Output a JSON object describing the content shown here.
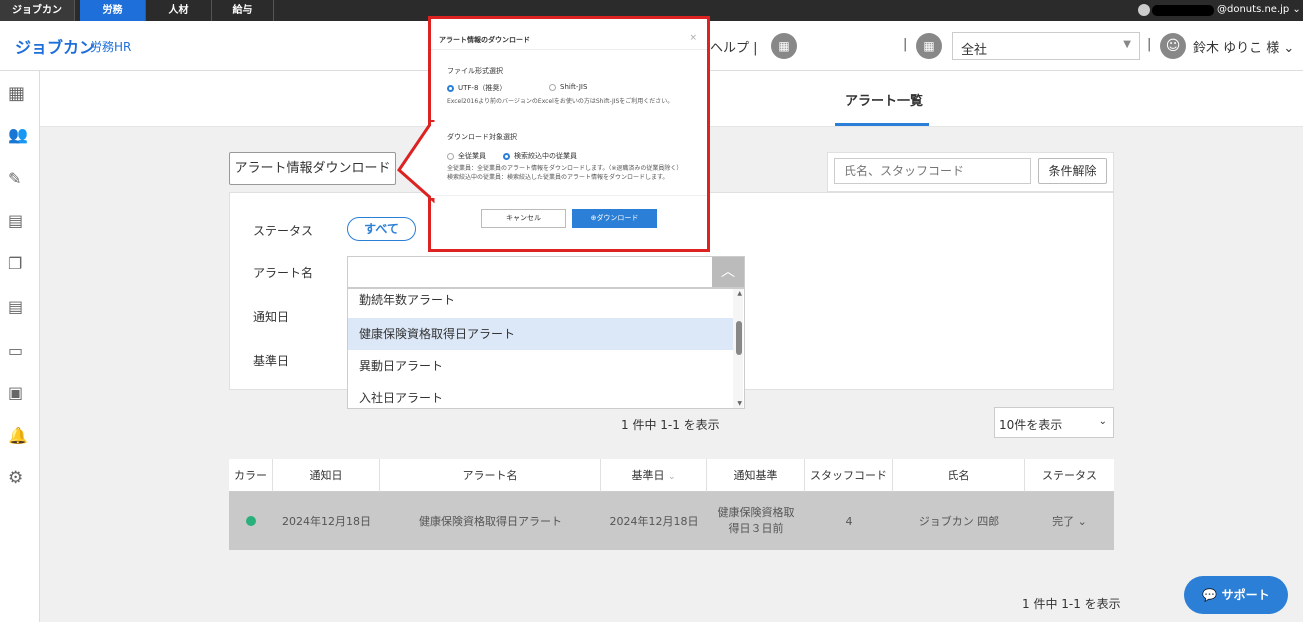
{
  "topbar": {
    "brand": "ジョブカン",
    "tabs": [
      "労務",
      "人材",
      "給与"
    ],
    "account_email": "@donuts.ne.jp"
  },
  "header": {
    "logo": "ジョブカン",
    "product": "労務HR",
    "help": "ヘルプ",
    "company_select": "全社",
    "user_name": "鈴木 ゆりこ 様"
  },
  "tabs": {
    "alert_list": "アラート一覧"
  },
  "toolbar": {
    "download_button": "アラート情報ダウンロード",
    "search_placeholder": "氏名、スタッフコード",
    "clear_button": "条件解除"
  },
  "filters": {
    "status_label": "ステータス",
    "status_all": "すべて",
    "alert_name_label": "アラート名",
    "notify_date_label": "通知日",
    "base_date_label": "基準日",
    "alert_options": [
      "勤続年数アラート",
      "健康保険資格取得日アラート",
      "異動日アラート",
      "入社日アラート"
    ]
  },
  "pagination": {
    "summary_top": "1 件中 1-1 を表示",
    "summary_bottom": "1 件中 1-1 を表示",
    "page_size": "10件を表示"
  },
  "table": {
    "headers": [
      "カラー",
      "通知日",
      "アラート名",
      "基準日",
      "通知基準",
      "スタッフコード",
      "氏名",
      "ステータス"
    ],
    "rows": [
      {
        "color": "#2ab07a",
        "notify_date": "2024年12月18日",
        "alert_name": "健康保険資格取得日アラート",
        "base_date": "2024年12月18日",
        "criteria": "健康保険資格取得日３日前",
        "staff_code": "4",
        "name": "ジョブカン 四郎",
        "status": "完了"
      }
    ]
  },
  "support_button": "サポート",
  "modal": {
    "title": "アラート情報のダウンロード",
    "format_section": "ファイル形式選択",
    "format_utf8": "UTF-8（推奨）",
    "format_sjis": "Shift-JIS",
    "format_note": "Excel2016より前のバージョンのExcelをお使いの方はShift-JISをご利用ください。",
    "target_section": "ダウンロード対象選択",
    "target_all": "全従業員",
    "target_filtered": "検索絞込中の従業員",
    "target_note_1": "全従業員：全従業員のアラート情報をダウンロードします。（※退職済みの従業員除く）",
    "target_note_2": "検索絞込中の従業員：検索絞込した従業員のアラート情報をダウンロードします。",
    "cancel": "キャンセル",
    "download": "ダウンロード"
  },
  "colors": {
    "brand_blue": "#1e6fd9",
    "accent_blue": "#2b7fd6",
    "highlight_red": "#dd2222",
    "status_green": "#2ab07a"
  }
}
